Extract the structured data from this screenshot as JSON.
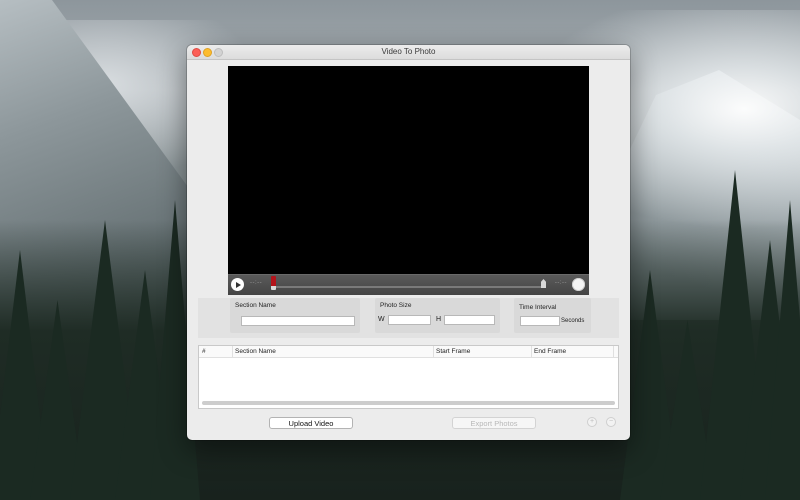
{
  "window": {
    "title": "Video To Photo"
  },
  "player": {
    "time_start": "--:--",
    "time_end": "--:--"
  },
  "settings": {
    "section_name_label": "Section Name",
    "section_name_value": "",
    "photo_size_label": "Photo Size",
    "width_label": "W",
    "height_label": "H",
    "width_value": "",
    "height_value": "",
    "time_interval_label": "Time Interval",
    "time_interval_value": "",
    "seconds_label": "Seconds"
  },
  "table": {
    "columns": [
      "#",
      "Section Name",
      "Start Frame",
      "End Frame"
    ],
    "rows": []
  },
  "actions": {
    "upload_label": "Upload Video",
    "export_label": "Export Photos",
    "add_label": "+",
    "remove_label": "−"
  },
  "colors": {
    "close": "#fc5f57",
    "minimize": "#fdbc2e",
    "start_marker": "#b3141b"
  }
}
